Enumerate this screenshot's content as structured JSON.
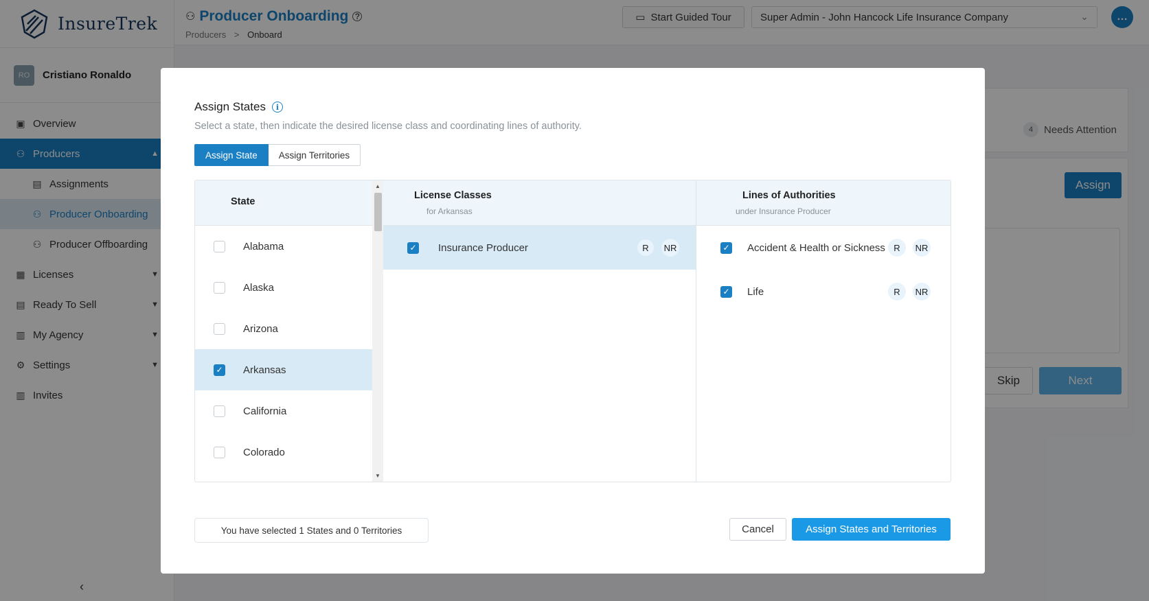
{
  "app": {
    "brand": "InsureTrek"
  },
  "user": {
    "initials": "RO",
    "name": "Cristiano Ronaldo"
  },
  "sidebar": {
    "items": [
      {
        "label": "Overview"
      },
      {
        "label": "Producers"
      },
      {
        "label": "Assignments"
      },
      {
        "label": "Producer Onboarding"
      },
      {
        "label": "Producer Offboarding"
      },
      {
        "label": "Licenses"
      },
      {
        "label": "Ready To Sell"
      },
      {
        "label": "My Agency"
      },
      {
        "label": "Settings"
      },
      {
        "label": "Invites"
      }
    ]
  },
  "header": {
    "title": "Producer Onboarding",
    "breadcrumb": {
      "root": "Producers",
      "sep": ">",
      "current": "Onboard"
    },
    "tour_label": "Start Guided Tour",
    "company": "Super Admin - John Hancock Life Insurance Company"
  },
  "background": {
    "needs_attention_count": "4",
    "needs_attention_label": "Needs Attention",
    "assign_label": "Assign",
    "skip_label": "Skip",
    "next_label": "Next"
  },
  "modal": {
    "title": "Assign States",
    "subtitle": "Select a state, then indicate the desired license class and coordinating lines of authority.",
    "tabs": {
      "state": "Assign State",
      "territories": "Assign Territories"
    },
    "state_header": "State",
    "states": [
      {
        "name": "Alabama",
        "checked": false
      },
      {
        "name": "Alaska",
        "checked": false
      },
      {
        "name": "Arizona",
        "checked": false
      },
      {
        "name": "Arkansas",
        "checked": true
      },
      {
        "name": "California",
        "checked": false
      },
      {
        "name": "Colorado",
        "checked": false
      }
    ],
    "license": {
      "header": "License Classes",
      "subheader": "for Arkansas",
      "row": {
        "name": "Insurance Producer",
        "r": "R",
        "nr": "NR"
      }
    },
    "loa": {
      "header": "Lines of Authorities",
      "subheader": "under Insurance Producer",
      "rows": [
        {
          "name": "Accident & Health or Sickness",
          "r": "R",
          "nr": "NR"
        },
        {
          "name": "Life",
          "r": "R",
          "nr": "NR"
        }
      ]
    },
    "summary": "You have selected 1 States and 0 Territories",
    "cancel_label": "Cancel",
    "submit_label": "Assign States and Territories"
  },
  "colors": {
    "primary": "#1b7fc4",
    "submit": "#1a9ae6",
    "selected_row": "#d8eaf6",
    "header_bg": "#eef6fc"
  }
}
